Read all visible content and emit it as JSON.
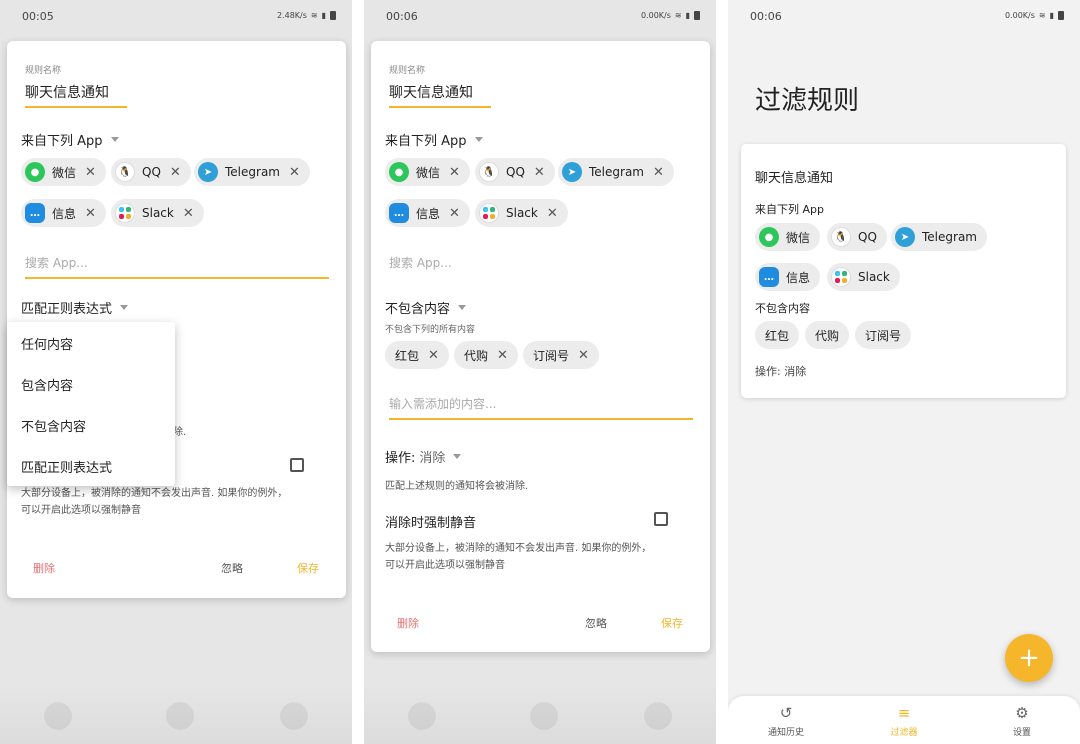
{
  "colors": {
    "accent": "#f5b62b",
    "delete": "#e57373"
  },
  "screen1": {
    "status": {
      "time": "00:05",
      "speed": "2.48K/s"
    },
    "rule_name_label": "规则名称",
    "rule_name": "聊天信息通知",
    "from_apps_label": "来自下列 App",
    "apps": [
      "微信",
      "QQ",
      "Telegram",
      "信息",
      "Slack"
    ],
    "search_placeholder": "搜索 App...",
    "match_mode_label": "匹配正则表达式",
    "dropdown_options": [
      "任何内容",
      "包含内容",
      "不包含内容",
      "匹配正则表达式"
    ],
    "partial_hint": "除.",
    "mute_desc_line1": "大部分设备上，被消除的通知不会发出声音. 如果你的例外，",
    "mute_desc_line2": "可以开启此选项以强制静音",
    "buttons": {
      "delete": "删除",
      "ignore": "忽略",
      "save": "保存"
    }
  },
  "screen2": {
    "status": {
      "time": "00:06",
      "speed": "0.00K/s"
    },
    "rule_name_label": "规则名称",
    "rule_name": "聊天信息通知",
    "from_apps_label": "来自下列 App",
    "apps": [
      "微信",
      "QQ",
      "Telegram",
      "信息",
      "Slack"
    ],
    "search_placeholder": "搜索 App...",
    "match_mode_label": "不包含内容",
    "match_mode_hint": "不包含下列的所有内容",
    "keywords": [
      "红包",
      "代购",
      "订阅号"
    ],
    "keyword_placeholder": "输入需添加的内容...",
    "action_label": "操作:",
    "action_value": "消除",
    "action_hint": "匹配上述规则的通知将会被消除.",
    "force_mute_label": "消除时强制静音",
    "mute_desc_line1": "大部分设备上，被消除的通知不会发出声音. 如果你的例外，",
    "mute_desc_line2": "可以开启此选项以强制静音",
    "buttons": {
      "delete": "删除",
      "ignore": "忽略",
      "save": "保存"
    }
  },
  "screen3": {
    "status": {
      "time": "00:06",
      "speed": "0.00K/s"
    },
    "title": "过滤规则",
    "rule": {
      "name": "聊天信息通知",
      "from_apps_label": "来自下列 App",
      "apps": [
        "微信",
        "QQ",
        "Telegram",
        "信息",
        "Slack"
      ],
      "mode_label": "不包含内容",
      "keywords": [
        "红包",
        "代购",
        "订阅号"
      ],
      "action": "操作: 消除"
    },
    "fab": "+",
    "nav": [
      {
        "label": "通知历史",
        "icon": "history-icon"
      },
      {
        "label": "过滤器",
        "icon": "filter-icon"
      },
      {
        "label": "设置",
        "icon": "gear-icon"
      }
    ]
  }
}
